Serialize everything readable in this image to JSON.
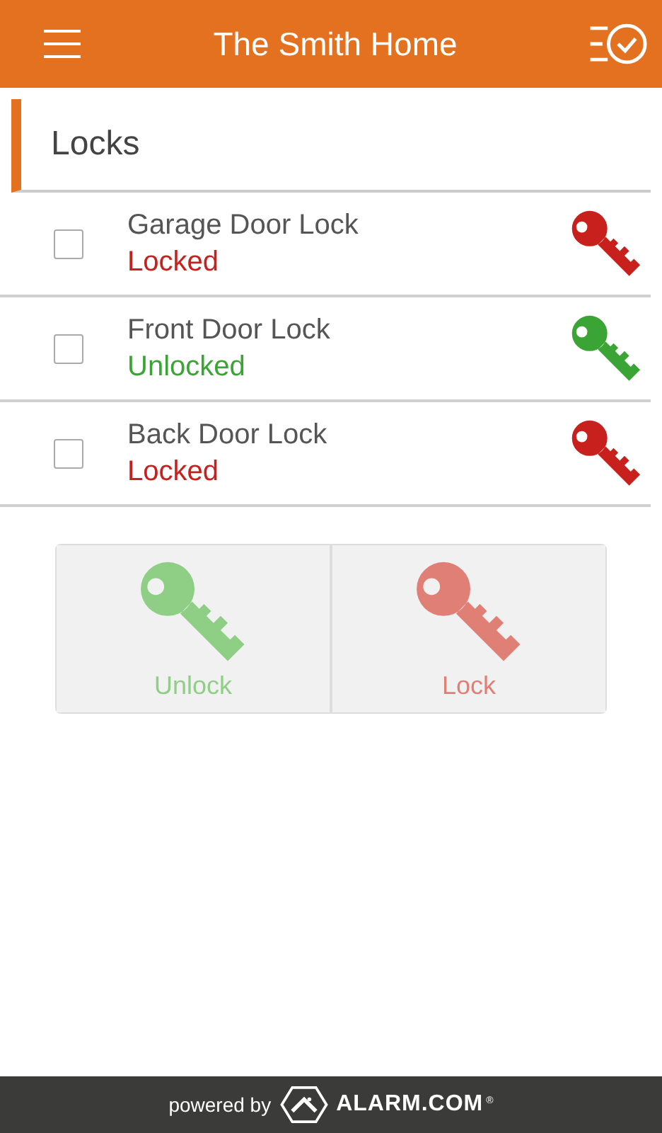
{
  "header": {
    "title": "The Smith Home"
  },
  "section": {
    "title": "Locks"
  },
  "locks": [
    {
      "name": "Garage Door Lock",
      "status": "Locked",
      "locked": true,
      "checked": false
    },
    {
      "name": "Front Door Lock",
      "status": "Unlocked",
      "locked": false,
      "checked": false
    },
    {
      "name": "Back Door Lock",
      "status": "Locked",
      "locked": true,
      "checked": false
    }
  ],
  "actions": [
    {
      "label": "Unlock",
      "kind": "unlock"
    },
    {
      "label": "Lock",
      "kind": "lock"
    }
  ],
  "footer": {
    "prefix": "powered by",
    "brand": "ALARM.COM",
    "mark": "®"
  }
}
